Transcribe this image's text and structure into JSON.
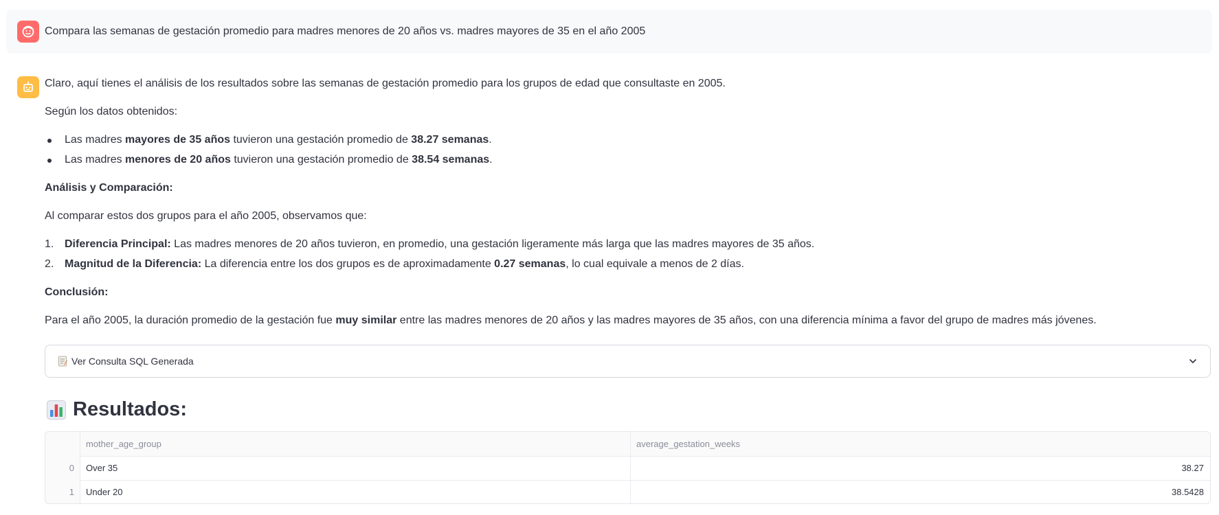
{
  "user_message": {
    "text": "Compara las semanas de gestación promedio para madres menores de 20 años vs. madres mayores de 35 en el año 2005",
    "avatar_icon": "face-icon",
    "avatar_color": "#ff6b6b"
  },
  "assistant_message": {
    "avatar_icon": "robot-icon",
    "avatar_color": "#ffbd45",
    "intro": "Claro, aquí tienes el análisis de los resultados sobre las semanas de gestación promedio para los grupos de edad que consultaste en 2005.",
    "data_intro": "Según los datos obtenidos:",
    "bullets": [
      {
        "pre": "Las madres ",
        "bold": "mayores de 35 años",
        "mid": " tuvieron una gestación promedio de ",
        "bold2": "38.27 semanas",
        "post": "."
      },
      {
        "pre": "Las madres ",
        "bold": "menores de 20 años",
        "mid": " tuvieron una gestación promedio de ",
        "bold2": "38.54 semanas",
        "post": "."
      }
    ],
    "analysis_heading": "Análisis y Comparación:",
    "analysis_intro": "Al comparar estos dos grupos para el año 2005, observamos que:",
    "numbered": [
      {
        "num": "1.",
        "bold": "Diferencia Principal:",
        "text": " Las madres menores de 20 años tuvieron, en promedio, una gestación ligeramente más larga que las madres mayores de 35 años.",
        "bold2": "",
        "post": ""
      },
      {
        "num": "2.",
        "bold": "Magnitud de la Diferencia:",
        "text": " La diferencia entre los dos grupos es de aproximadamente ",
        "bold2": "0.27 semanas",
        "post": ", lo cual equivale a menos de 2 días."
      }
    ],
    "conclusion_heading": "Conclusión:",
    "conclusion": {
      "pre": "Para el año 2005, la duración promedio de la gestación fue ",
      "bold": "muy similar",
      "post": " entre las madres menores de 20 años y las madres mayores de 35 años, con una diferencia mínima a favor del grupo de madres más jóvenes."
    }
  },
  "expander": {
    "label": "Ver Consulta SQL Generada",
    "icon": "memo-icon",
    "chevron": "chevron-down-icon"
  },
  "results": {
    "title": "Resultados:",
    "icon": "bar-chart-icon",
    "columns": [
      "",
      "mother_age_group",
      "average_gestation_weeks"
    ],
    "rows": [
      {
        "index": "0",
        "mother_age_group": "Over 35",
        "average_gestation_weeks": "38.27"
      },
      {
        "index": "1",
        "mother_age_group": "Under 20",
        "average_gestation_weeks": "38.5428"
      }
    ]
  }
}
